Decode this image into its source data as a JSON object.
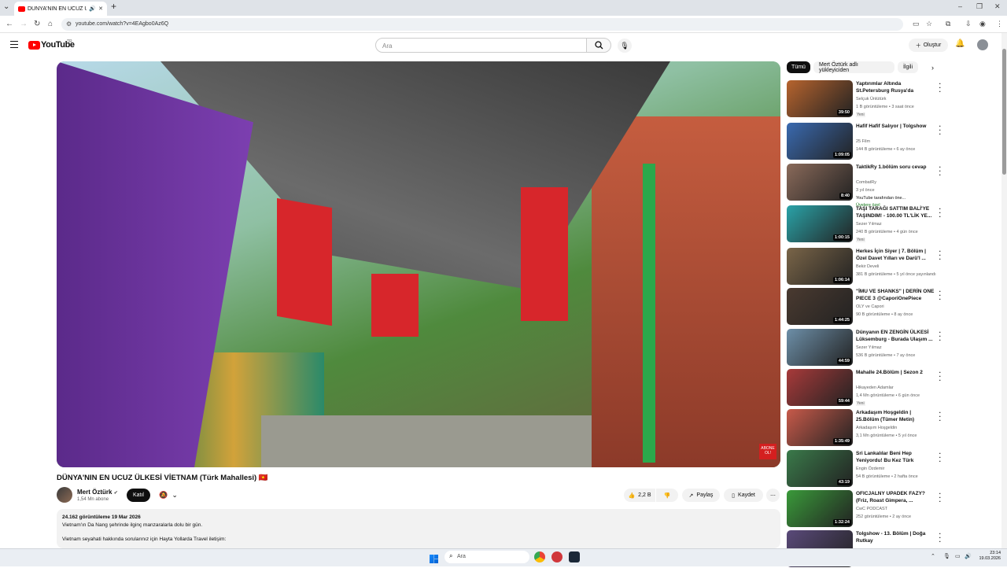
{
  "browser": {
    "tab_title": "DÜNYA'NIN EN UCUZ ÜLKE",
    "url": "youtube.com/watch?v=4EAgbo0Az6Q",
    "new_tab": "+"
  },
  "header": {
    "logo_text": "YouTube",
    "logo_region": "TR",
    "search_placeholder": "Ara",
    "create_label": "Oluştur"
  },
  "video": {
    "title": "DÜNYA'NIN EN UCUZ ÜLKESİ VİETNAM (Türk Mahallesi) 🇻🇳",
    "channel": "Mert Öztürk",
    "subscribers": "1,54 Mn abone",
    "join_label": "Katıl",
    "likes": "2,2 B",
    "share_label": "Paylaş",
    "save_label": "Kaydet",
    "overlay_badge": "ABONE OL!"
  },
  "description": {
    "views_date": "24.162 görüntüleme  19 Mar 2026",
    "line1": "Vietnam'ın Da Nang şehrinde ilginç manzaralarla dolu bir gün.",
    "line2": "Vietnam seyahati hakkında sorularınız için Hayta Yollarda Travel iletişim:"
  },
  "chips": [
    "Tümü",
    "Mert Öztürk adlı yükleyiciden",
    "İlgili"
  ],
  "recommendations": [
    {
      "title": "Yaptırımlar Altında St.Petersburg Rusya'da Yaşam...",
      "channel": "Selçuk Ünlütürk",
      "meta": "1 B görüntüleme • 3 saat önce",
      "badge": "Yeni",
      "duration": "39:50",
      "thumb_color": "#b7642e"
    },
    {
      "title": "Hafif Hafif Salıyor | Tolgshow",
      "channel": "25 Film",
      "meta": "144 B görüntüleme • 6 ay önce",
      "badge": "",
      "duration": "1:09:05",
      "thumb_color": "#3a6ab0"
    },
    {
      "title": "TaktikRy 1.bölüm soru cevap",
      "channel": "CombatRy",
      "meta": "3 yıl önce",
      "badge": "",
      "extra": "YouTube tarafından öne...",
      "extra2": "Üyelere özel",
      "duration": "8:40",
      "thumb_color": "#8a6a5a"
    },
    {
      "title": "TAŞI TARAĞI SATTIM BALİ'YE TAŞINDIM! - 100.00 TL'LİK YE...",
      "channel": "Sezer Yılmaz",
      "meta": "240 B görüntüleme • 4 gün önce",
      "badge": "Yeni",
      "duration": "1:00:15",
      "thumb_color": "#2aa3a8"
    },
    {
      "title": "Herkes İçin Siyer | 7. Bölüm | Özel Davet Yılları ve Darü'l ...",
      "channel": "Bekir Develi",
      "meta": "381 B görüntüleme • 5 yıl önce yayınlandı",
      "badge": "",
      "duration": "1:06:14",
      "thumb_color": "#7a6548"
    },
    {
      "title": "\"İMU VE SHANKS\" | DERİN ONE PIECE 3 @CaporiOnePiece",
      "channel": "OLY ve Capori",
      "meta": "90 B görüntüleme • 8 ay önce",
      "badge": "",
      "duration": "1:44:25",
      "thumb_color": "#4a3a30"
    },
    {
      "title": "Dünyanın EN ZENGİN ÜLKESİ Lüksemburg - Burada Ulaşım ...",
      "channel": "Sezer Yılmaz",
      "meta": "536 B görüntüleme • 7 ay önce",
      "badge": "",
      "duration": "44:59",
      "thumb_color": "#6d8fa8"
    },
    {
      "title": "Mahalle 24.Bölüm | Sezon 2",
      "channel": "Hikayeden Adamlar",
      "meta": "1,4 Mn görüntüleme • 6 gün önce",
      "badge": "Yeni",
      "duration": "59:44",
      "thumb_color": "#a83a3a"
    },
    {
      "title": "Arkadaşım Hoşgeldin | 25.Bölüm (Tümer Metin)",
      "channel": "Arkadaşım Hoşgeldin",
      "meta": "3,1 Mn görüntüleme • 5 yıl önce",
      "badge": "",
      "duration": "1:35:49",
      "thumb_color": "#c85a4a"
    },
    {
      "title": "Sri Lankalılar Beni Hep Yeniyordu! Bu Kez Türk Takımı...",
      "channel": "Engin Özdemir",
      "meta": "54 B görüntüleme • 2 hafta önce",
      "badge": "",
      "duration": "43:19",
      "thumb_color": "#3a7a4a"
    },
    {
      "title": "OFICJALNY UPADEK FAZY? (Friz, Roast Gimpera, ...",
      "channel": "CwC PODCAST",
      "meta": "252 görüntüleme • 2 ay önce",
      "badge": "",
      "duration": "1:32:24",
      "thumb_color": "#3a9a3a"
    },
    {
      "title": "Tolgshow - 13. Bölüm | Doğa Rutkay",
      "channel": "",
      "meta": "",
      "badge": "",
      "duration": "",
      "thumb_color": "#5a4a7a"
    }
  ],
  "taskbar": {
    "search_placeholder": "Ara",
    "time": "23:14",
    "date": "19.03.2026"
  }
}
